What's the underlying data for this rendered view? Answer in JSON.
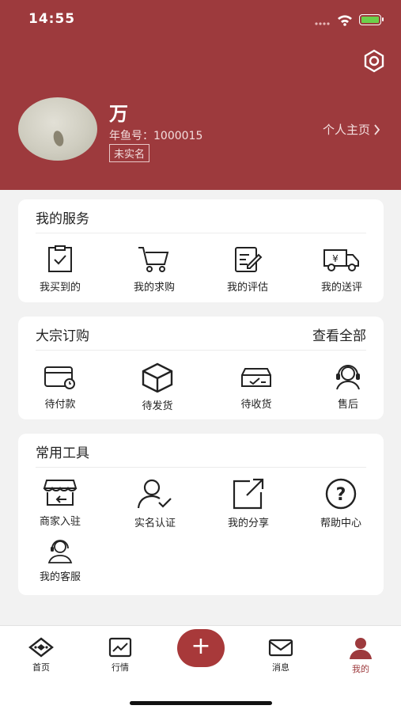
{
  "status_bar": {
    "time": "14:55"
  },
  "profile": {
    "name": "万",
    "id_text": "年鱼号：1000015",
    "verify_badge": "未实名",
    "homepage_link": "个人主页",
    "header_color": "#9d3a3d"
  },
  "my_services": {
    "title": "我的服务",
    "items": [
      {
        "label": "我买到的",
        "icon": "clipboard-check-icon"
      },
      {
        "label": "我的求购",
        "icon": "shopping-cart-icon"
      },
      {
        "label": "我的评估",
        "icon": "edit-document-icon"
      },
      {
        "label": "我的送评",
        "icon": "delivery-truck-icon"
      }
    ]
  },
  "bulk_orders": {
    "title": "大宗订购",
    "view_all": "查看全部",
    "items": [
      {
        "label": "待付款",
        "icon": "wallet-card-icon"
      },
      {
        "label": "待发货",
        "icon": "package-box-icon"
      },
      {
        "label": "待收货",
        "icon": "inbox-tray-icon"
      },
      {
        "label": "售后",
        "icon": "headset-agent-icon"
      }
    ]
  },
  "tools": {
    "title": "常用工具",
    "items": [
      {
        "label": "商家入驻",
        "icon": "shop-store-icon"
      },
      {
        "label": "实名认证",
        "icon": "user-verify-icon"
      },
      {
        "label": "我的分享",
        "icon": "share-export-icon"
      },
      {
        "label": "帮助中心",
        "icon": "help-question-icon"
      },
      {
        "label": "我的客服",
        "icon": "customer-service-icon"
      }
    ]
  },
  "tabbar": {
    "items": [
      {
        "label": "首页",
        "icon": "home-icon"
      },
      {
        "label": "行情",
        "icon": "market-chart-icon"
      },
      {
        "label": "",
        "icon": "plus-icon"
      },
      {
        "label": "消息",
        "icon": "mail-icon"
      },
      {
        "label": "我的",
        "icon": "person-icon"
      }
    ],
    "active": "我的",
    "active_color": "#9d3a3d"
  }
}
